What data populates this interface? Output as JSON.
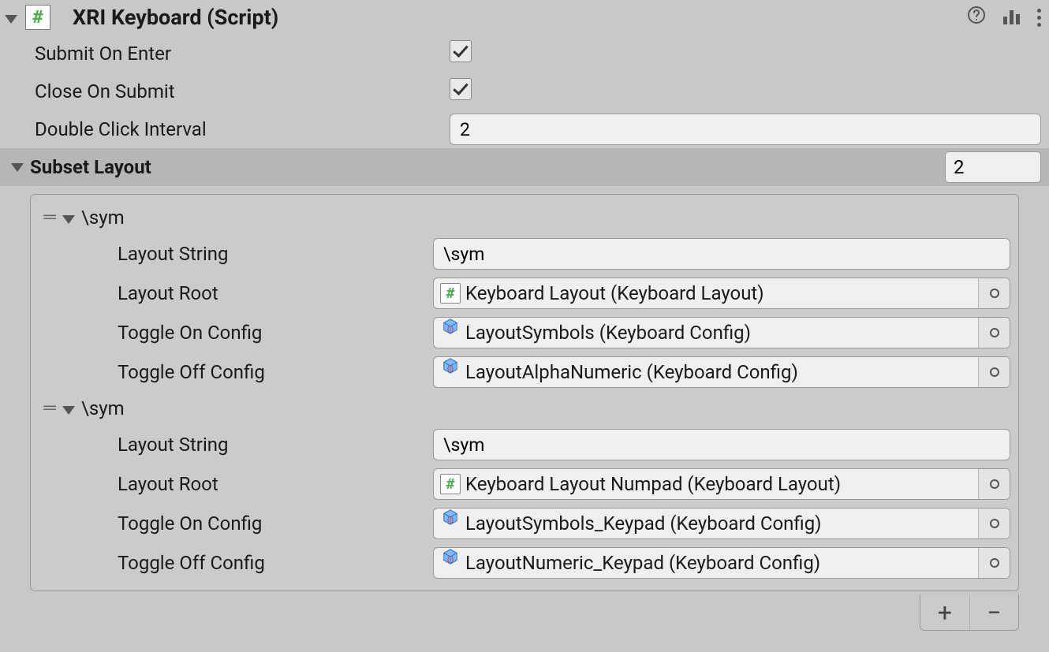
{
  "header": {
    "title": "XRI Keyboard (Script)"
  },
  "fields": {
    "submit_on_enter_label": "Submit On Enter",
    "submit_on_enter_checked": true,
    "close_on_submit_label": "Close On Submit",
    "close_on_submit_checked": true,
    "double_click_interval_label": "Double Click Interval",
    "double_click_interval_value": "2"
  },
  "subset_layout": {
    "title": "Subset Layout",
    "count": "2",
    "labels": {
      "layout_string": "Layout String",
      "layout_root": "Layout Root",
      "toggle_on_config": "Toggle On Config",
      "toggle_off_config": "Toggle Off Config"
    },
    "items": [
      {
        "name": "\\sym",
        "layout_string": "\\sym",
        "layout_root": "Keyboard Layout (Keyboard Layout)",
        "toggle_on_config": "LayoutSymbols (Keyboard Config)",
        "toggle_off_config": "LayoutAlphaNumeric (Keyboard Config)"
      },
      {
        "name": "\\sym",
        "layout_string": "\\sym",
        "layout_root": "Keyboard Layout Numpad (Keyboard Layout)",
        "toggle_on_config": "LayoutSymbols_Keypad (Keyboard Config)",
        "toggle_off_config": "LayoutNumeric_Keypad (Keyboard Config)"
      }
    ]
  },
  "icons": {
    "script_badge": "#",
    "help": "?",
    "add": "+",
    "remove": "−"
  }
}
